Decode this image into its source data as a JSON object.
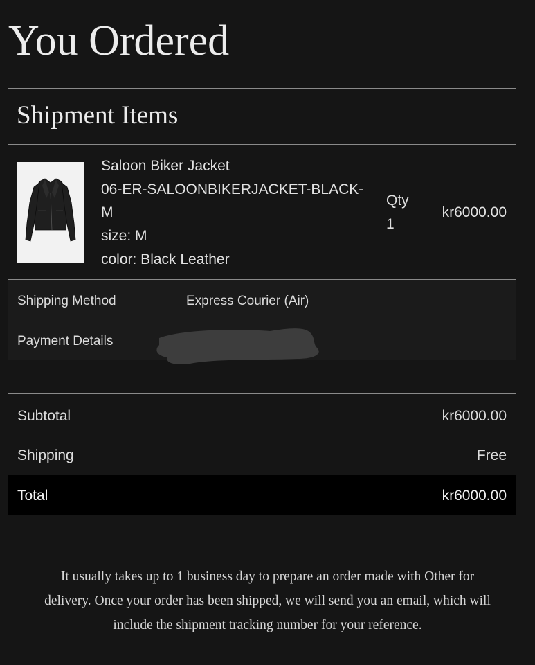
{
  "page": {
    "title": "You Ordered",
    "section_title": "Shipment Items"
  },
  "item": {
    "image_icon": "leather-jacket-image",
    "name": "Saloon Biker Jacket",
    "sku_line1": "06-ER-SALOONBIKERJACKET-BLACK-",
    "sku_line2": "M",
    "size": "size: M",
    "color": "color: Black Leather",
    "qty_label": "Qty",
    "qty_value": "1",
    "price": "kr6000.00"
  },
  "details": {
    "shipping_method_label": "Shipping Method",
    "shipping_method_value": "Express Courier (Air)",
    "payment_details_label": "Payment Details",
    "payment_details_redacted": true
  },
  "summary": {
    "subtotal_label": "Subtotal",
    "subtotal_value": "kr6000.00",
    "shipping_label": "Shipping",
    "shipping_value": "Free",
    "total_label": "Total",
    "total_value": "kr6000.00"
  },
  "note": {
    "line1": "It usually takes up to 1 business day to prepare an order made with Other for",
    "line2": "delivery. Once your order has been shipped, we will send you an email, which will",
    "line3": "include the shipment tracking number for your reference."
  },
  "colors": {
    "background": "#151515",
    "panel": "#1b1b1b",
    "total_bar": "#000000",
    "text": "#e6e6e6",
    "rule": "#8a8a8a"
  }
}
